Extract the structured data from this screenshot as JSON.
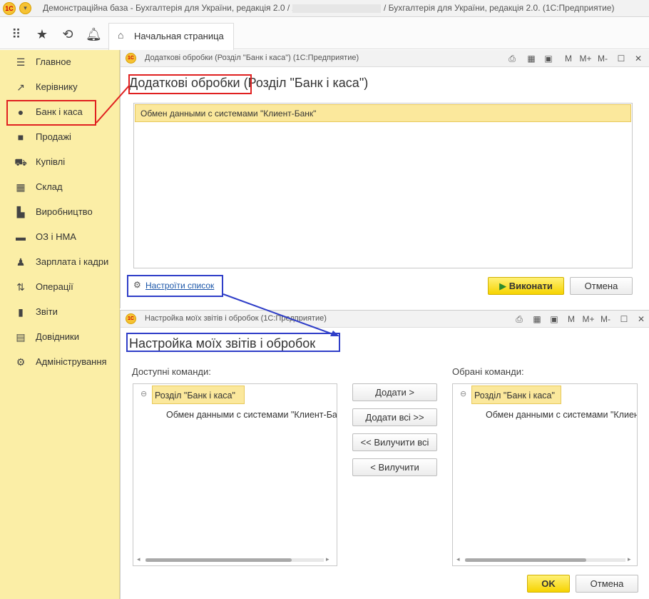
{
  "titlebar": {
    "text": "Демонстраційна база - Бухгалтерія для України, редакція 2.0 / Админ",
    "text_suffix": "/ Бухгалтерія для України, редакція 2.0.  (1С:Предприятие)",
    "logo": "1С"
  },
  "toolbar": {
    "icons": [
      "apps-grid-icon",
      "star-icon",
      "history-icon",
      "bell-icon"
    ],
    "home_tab": "Начальная страница"
  },
  "sidebar": {
    "items": [
      {
        "label": "Главное",
        "icon": "menu-icon"
      },
      {
        "label": "Керівнику",
        "icon": "trend-icon"
      },
      {
        "label": "Банк і каса",
        "icon": "coin-icon"
      },
      {
        "label": "Продажі",
        "icon": "bag-icon"
      },
      {
        "label": "Купівлі",
        "icon": "cart-icon"
      },
      {
        "label": "Склад",
        "icon": "grid-icon"
      },
      {
        "label": "Виробництво",
        "icon": "factory-icon"
      },
      {
        "label": "ОЗ і НМА",
        "icon": "truck-icon"
      },
      {
        "label": "Зарплата і кадри",
        "icon": "person-icon"
      },
      {
        "label": "Операції",
        "icon": "operations-icon"
      },
      {
        "label": "Звіти",
        "icon": "bar-chart-icon"
      },
      {
        "label": "Довідники",
        "icon": "book-icon"
      },
      {
        "label": "Адміністрування",
        "icon": "gear-icon"
      }
    ]
  },
  "window1": {
    "title": "Додаткові обробки (Розділ \"Банк і каса\")  (1С:Предприятие)",
    "heading_a": "Додаткові обробки",
    "heading_b": " (Розділ \"Банк і каса\")",
    "controls": [
      "М",
      "М+",
      "М-"
    ],
    "list_item": "Обмен данными с системами \"Клиент-Банк\"",
    "settings_link": "Настроїти список",
    "execute_button": "Виконати",
    "cancel_button": "Отмена"
  },
  "window2": {
    "title": "Настройка моїх звітів і обробок  (1С:Предприятие)",
    "heading": "Настройка моїх звітів і обробок",
    "available_label": "Доступні команди:",
    "selected_label": "Обрані команди:",
    "available_group": "Розділ \"Банк і каса\"",
    "available_child": "Обмен данными с системами \"Клиент-Банк\"",
    "selected_group": "Розділ \"Банк і каса\"",
    "selected_child": "Обмен данными с системами \"Клиент-Банк\"",
    "add_button": "Додати >",
    "add_all_button": "Додати всі >>",
    "remove_all_button": "<< Вилучити всі",
    "remove_button": "< Вилучити",
    "ok_button": "OK",
    "cancel_button": "Отмена"
  },
  "colors": {
    "sidebar_bg": "#fbeea6",
    "selection": "#fbe89c",
    "primary_button": "#f6d300",
    "annotation_red": "#e02020",
    "annotation_blue": "#2f3ec8"
  }
}
